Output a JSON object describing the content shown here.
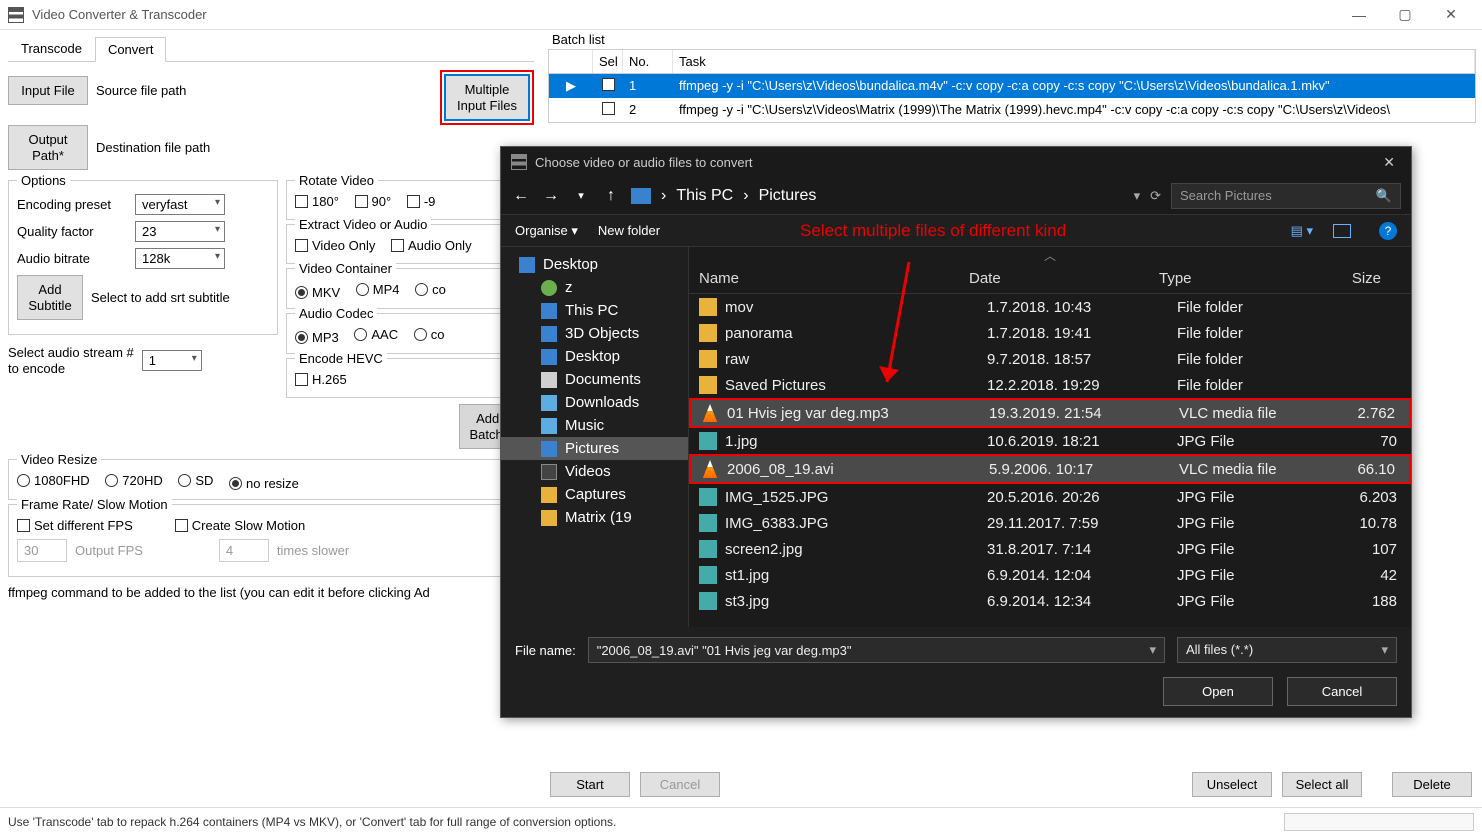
{
  "window": {
    "title": "Video Converter & Transcoder"
  },
  "tabs": {
    "transcode": "Transcode",
    "convert": "Convert"
  },
  "convert": {
    "input_btn": "Input File",
    "source_label": "Source file path",
    "multi_btn_l1": "Multiple",
    "multi_btn_l2": "Input Files",
    "output_btn_l1": "Output",
    "output_btn_l2": "Path*",
    "dest_label": "Destination file path",
    "rotate": {
      "legend": "Rotate Video",
      "o180": "180°",
      "o90": "90°",
      "om90": "-9"
    },
    "extract": {
      "legend": "Extract Video or Audio",
      "vo": "Video Only",
      "ao": "Audio Only"
    },
    "options_legend": "Options",
    "preset_label": "Encoding preset",
    "preset_val": "veryfast",
    "quality_label": "Quality factor",
    "quality_val": "23",
    "abitrate_label": "Audio bitrate",
    "abitrate_val": "128k",
    "addsub_l1": "Add",
    "addsub_l2": "Subtitle",
    "addsub_desc": "Select to add srt subtitle",
    "vcont": {
      "legend": "Video Container",
      "mkv": "MKV",
      "mp4": "MP4",
      "co": "co"
    },
    "acodec": {
      "legend": "Audio Codec",
      "mp3": "MP3",
      "aac": "AAC",
      "co": "co"
    },
    "hevc": {
      "legend": "Encode HEVC",
      "h265": "H.265"
    },
    "astream_l1": "Select audio stream #",
    "astream_l2": "to encode",
    "astream_val": "1",
    "addbatch_l1": "Add To",
    "addbatch_l2": "Batch Lis",
    "resize": {
      "legend": "Video Resize",
      "fhd": "1080FHD",
      "hd": "720HD",
      "sd": "SD",
      "none": "no resize"
    },
    "fps": {
      "legend": "Frame Rate/ Slow Motion",
      "setdiff": "Set different FPS",
      "slow": "Create Slow Motion",
      "fps_val": "30",
      "fps_ph": "Output FPS",
      "times_val": "4",
      "times_ph": "times slower"
    },
    "cmd_label": "ffmpeg command to be added to the list (you can edit it before clicking Ad"
  },
  "batch": {
    "title": "Batch list",
    "cols": {
      "sel": "Sel",
      "no": "No.",
      "task": "Task"
    },
    "rows": [
      {
        "no": "1",
        "task": "ffmpeg -y -i \"C:\\Users\\z\\Videos\\bundalica.m4v\" -c:v copy -c:a copy -c:s copy \"C:\\Users\\z\\Videos\\bundalica.1.mkv\"",
        "selected": true
      },
      {
        "no": "2",
        "task": "ffmpeg -y -i \"C:\\Users\\z\\Videos\\Matrix (1999)\\The Matrix (1999).hevc.mp4\" -c:v copy -c:a copy -c:s copy \"C:\\Users\\z\\Videos\\",
        "selected": false
      }
    ]
  },
  "bottom": {
    "start": "Start",
    "cancel": "Cancel",
    "unselect": "Unselect",
    "selectall": "Select all",
    "delete": "Delete"
  },
  "status": "Use 'Transcode' tab to repack h.264 containers (MP4 vs MKV), or 'Convert' tab for full range of conversion options.",
  "dialog": {
    "title": "Choose video or audio files to convert",
    "crumbs": [
      "This PC",
      "Pictures"
    ],
    "search_ph": "Search Pictures",
    "organise": "Organise",
    "newfolder": "New folder",
    "annotation": "Select multiple files of different kind",
    "tree": [
      {
        "label": "Desktop",
        "cls": "ico-desktop"
      },
      {
        "label": "z",
        "cls": "ico-user",
        "sub": true
      },
      {
        "label": "This PC",
        "cls": "ico-pc",
        "sub": true
      },
      {
        "label": "3D Objects",
        "cls": "ico-3d",
        "sub": true
      },
      {
        "label": "Desktop",
        "cls": "ico-desktop",
        "sub": true
      },
      {
        "label": "Documents",
        "cls": "ico-doc",
        "sub": true
      },
      {
        "label": "Downloads",
        "cls": "ico-dl",
        "sub": true
      },
      {
        "label": "Music",
        "cls": "ico-music",
        "sub": true
      },
      {
        "label": "Pictures",
        "cls": "ico-pic",
        "sub": true,
        "sel": true
      },
      {
        "label": "Videos",
        "cls": "ico-vid",
        "sub": true
      },
      {
        "label": "Captures",
        "cls": "ico-folder",
        "sub": true
      },
      {
        "label": "Matrix (19",
        "cls": "ico-folder",
        "sub": true
      }
    ],
    "cols": {
      "name": "Name",
      "date": "Date",
      "type": "Type",
      "size": "Size"
    },
    "files": [
      {
        "icon": "fico-folder",
        "name": "mov",
        "date": "1.7.2018. 10:43",
        "type": "File folder",
        "size": ""
      },
      {
        "icon": "fico-folder",
        "name": "panorama",
        "date": "1.7.2018. 19:41",
        "type": "File folder",
        "size": ""
      },
      {
        "icon": "fico-folder",
        "name": "raw",
        "date": "9.7.2018. 18:57",
        "type": "File folder",
        "size": ""
      },
      {
        "icon": "fico-folder",
        "name": "Saved Pictures",
        "date": "12.2.2018. 19:29",
        "type": "File folder",
        "size": ""
      },
      {
        "icon": "fico-vlc",
        "name": "01 Hvis jeg var deg.mp3",
        "date": "19.3.2019. 21:54",
        "type": "VLC media file",
        "size": "2.762",
        "sel": true,
        "red": true
      },
      {
        "icon": "fico-jpg",
        "name": "1.jpg",
        "date": "10.6.2019. 18:21",
        "type": "JPG File",
        "size": "70"
      },
      {
        "icon": "fico-vlc",
        "name": "2006_08_19.avi",
        "date": "5.9.2006. 10:17",
        "type": "VLC media file",
        "size": "66.10",
        "sel": true,
        "red": true
      },
      {
        "icon": "fico-jpg",
        "name": "IMG_1525.JPG",
        "date": "20.5.2016. 20:26",
        "type": "JPG File",
        "size": "6.203"
      },
      {
        "icon": "fico-jpg",
        "name": "IMG_6383.JPG",
        "date": "29.11.2017. 7:59",
        "type": "JPG File",
        "size": "10.78"
      },
      {
        "icon": "fico-jpg",
        "name": "screen2.jpg",
        "date": "31.8.2017. 7:14",
        "type": "JPG File",
        "size": "107"
      },
      {
        "icon": "fico-jpg",
        "name": "st1.jpg",
        "date": "6.9.2014. 12:04",
        "type": "JPG File",
        "size": "42"
      },
      {
        "icon": "fico-jpg",
        "name": "st3.jpg",
        "date": "6.9.2014. 12:34",
        "type": "JPG File",
        "size": "188"
      }
    ],
    "filename_label": "File name:",
    "filename_val": "\"2006_08_19.avi\" \"01 Hvis jeg var deg.mp3\"",
    "filter": "All files (*.*)",
    "open": "Open",
    "cancel": "Cancel"
  }
}
